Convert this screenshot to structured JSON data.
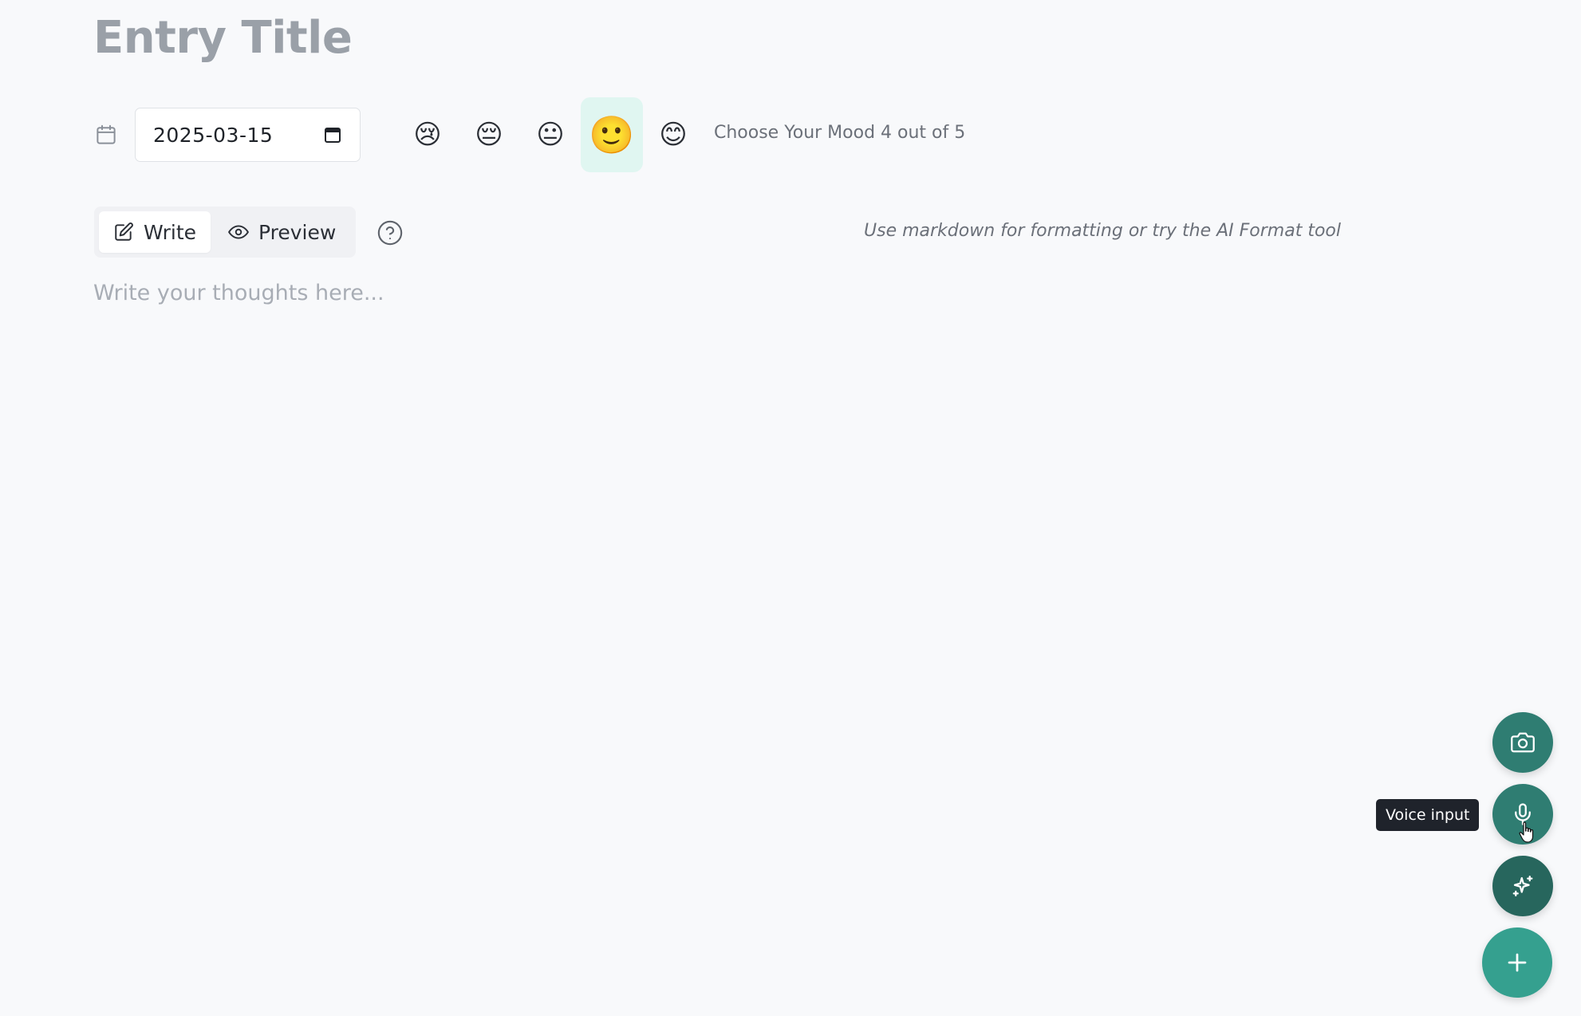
{
  "entry": {
    "title_placeholder": "Entry Title",
    "date_value": "2025-03-15"
  },
  "mood": {
    "options": [
      {
        "emoji": "😢",
        "selected": false
      },
      {
        "emoji": "😔",
        "selected": false
      },
      {
        "emoji": "😐",
        "selected": false
      },
      {
        "emoji": "🙂",
        "selected": true
      },
      {
        "emoji": "😊",
        "selected": false
      }
    ],
    "label": "Choose Your Mood 4 out of 5"
  },
  "editor_tabs": {
    "write_label": "Write",
    "preview_label": "Preview",
    "active": "write"
  },
  "hint": "Use markdown for formatting or try the AI Format tool",
  "editor": {
    "placeholder": "Write your thoughts here..."
  },
  "fabs": {
    "tooltip": "Voice input",
    "icons": [
      "camera-icon",
      "microphone-icon",
      "sparkles-icon",
      "plus-icon"
    ]
  },
  "colors": {
    "accent": "#2f7d72",
    "accent_light": "#35a08f",
    "mood_selected_bg": "#e0f6f1",
    "background": "#f8f9fb"
  }
}
